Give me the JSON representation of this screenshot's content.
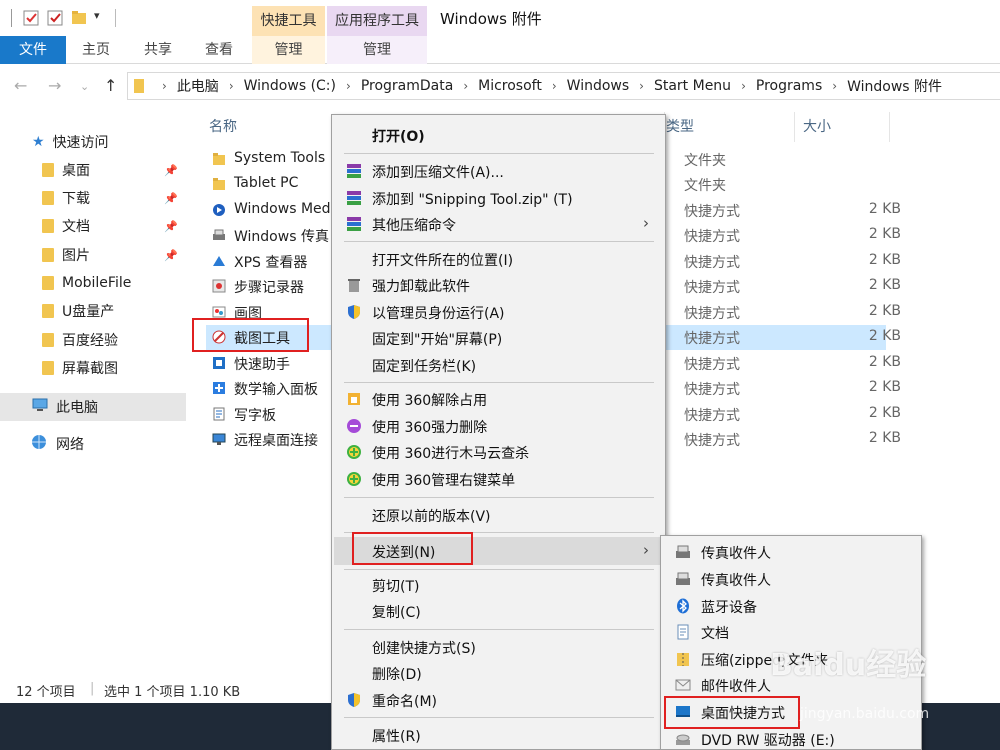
{
  "titlebar": {
    "title": "Windows 附件",
    "context_tab_shortcut": "快捷工具",
    "context_tab_app": "应用程序工具"
  },
  "ribbon": {
    "file": "文件",
    "home": "主页",
    "share": "共享",
    "view": "查看",
    "manage1": "管理",
    "manage2": "管理"
  },
  "address": {
    "crumbs": [
      "此电脑",
      "Windows (C:)",
      "ProgramData",
      "Microsoft",
      "Windows",
      "Start Menu",
      "Programs",
      "Windows 附件"
    ]
  },
  "navpane": {
    "quick_access": "快速访问",
    "items": [
      {
        "label": "桌面",
        "pinned": true
      },
      {
        "label": "下载",
        "pinned": true
      },
      {
        "label": "文档",
        "pinned": true
      },
      {
        "label": "图片",
        "pinned": true
      },
      {
        "label": "MobileFile",
        "pinned": false
      },
      {
        "label": "U盘量产",
        "pinned": false
      },
      {
        "label": "百度经验",
        "pinned": false
      },
      {
        "label": "屏幕截图",
        "pinned": false
      }
    ],
    "this_pc": "此电脑",
    "network": "网络"
  },
  "filelist": {
    "columns": {
      "name": "名称",
      "type": "类型",
      "size": "大小"
    },
    "rows": [
      {
        "name": "System Tools",
        "type": "文件夹",
        "size": ""
      },
      {
        "name": "Tablet PC",
        "type": "文件夹",
        "size": ""
      },
      {
        "name": "Windows Media",
        "type": "快捷方式",
        "size": "2 KB"
      },
      {
        "name": "Windows 传真",
        "type": "快捷方式",
        "size": "2 KB"
      },
      {
        "name": "XPS 查看器",
        "type": "快捷方式",
        "size": "2 KB"
      },
      {
        "name": "步骤记录器",
        "type": "快捷方式",
        "size": "2 KB"
      },
      {
        "name": "画图",
        "type": "快捷方式",
        "size": "2 KB"
      },
      {
        "name": "截图工具",
        "type": "快捷方式",
        "size": "2 KB",
        "selected": true
      },
      {
        "name": "快速助手",
        "type": "快捷方式",
        "size": "2 KB"
      },
      {
        "name": "数学输入面板",
        "type": "快捷方式",
        "size": "2 KB"
      },
      {
        "name": "写字板",
        "type": "快捷方式",
        "size": "2 KB"
      },
      {
        "name": "远程桌面连接",
        "type": "快捷方式",
        "size": "2 KB"
      }
    ]
  },
  "status": {
    "count": "12 个项目",
    "selection": "选中 1 个项目 1.10 KB"
  },
  "context_menu": {
    "open": "打开(O)",
    "add_archive": "添加到压缩文件(A)...",
    "add_zip": "添加到 \"Snipping Tool.zip\" (T)",
    "other_compress": "其他压缩命令",
    "open_location": "打开文件所在的位置(I)",
    "force_uninstall": "强力卸载此软件",
    "run_as_admin": "以管理员身份运行(A)",
    "pin_start": "固定到\"开始\"屏幕(P)",
    "pin_taskbar": "固定到任务栏(K)",
    "unlock_360": "使用 360解除占用",
    "delete_360": "使用 360强力删除",
    "scan_360": "使用 360进行木马云查杀",
    "manage_360": "使用 360管理右键菜单",
    "restore": "还原以前的版本(V)",
    "send_to": "发送到(N)",
    "cut": "剪切(T)",
    "copy": "复制(C)",
    "create_shortcut": "创建快捷方式(S)",
    "delete": "删除(D)",
    "rename": "重命名(M)",
    "properties": "属性(R)"
  },
  "send_to_menu": {
    "items": [
      "传真收件人",
      "传真收件人",
      "蓝牙设备",
      "文档",
      "压缩(zipped)文件夹",
      "邮件收件人",
      "桌面快捷方式",
      "DVD RW 驱动器 (E:)"
    ]
  },
  "watermark": {
    "text": "Baidu经验",
    "url": "jingyan.baidu.com"
  },
  "colors": {
    "accent": "#1979ca",
    "selection": "#cce8ff",
    "highlight_box": "#e02020"
  }
}
